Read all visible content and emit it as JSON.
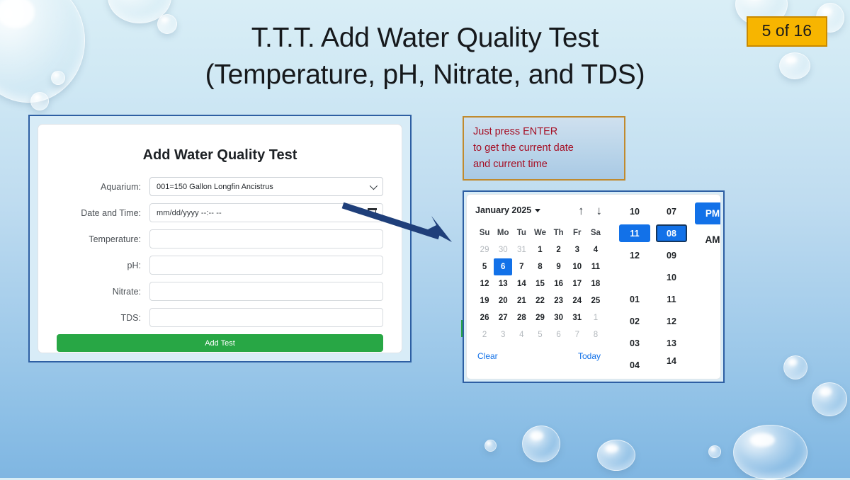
{
  "slide": {
    "title_line1": "T.T.T. Add Water Quality Test",
    "title_line2": "(Temperature, pH, Nitrate, and TDS)",
    "counter": "5 of 16",
    "counter_bg": "#f7b500",
    "background_top": "#d9eef6",
    "background_bottom": "#7fb6e2"
  },
  "form": {
    "heading": "Add Water Quality Test",
    "fields": [
      {
        "label": "Aquarium:",
        "value": "001=150 Gallon Longfin Ancistrus",
        "type": "select"
      },
      {
        "label": "Date and Time:",
        "value": "mm/dd/yyyy  --:--  --",
        "type": "datetime"
      },
      {
        "label": "Temperature:",
        "value": "",
        "type": "text"
      },
      {
        "label": "pH:",
        "value": "",
        "type": "text"
      },
      {
        "label": "Nitrate:",
        "value": "",
        "type": "text"
      },
      {
        "label": "TDS:",
        "value": "",
        "type": "text"
      }
    ],
    "submit_label": "Add Test",
    "submit_color": "#28a745",
    "frame_border": "#2e5fa3"
  },
  "note": {
    "line1": "Just press ENTER",
    "line2": "to get the current date",
    "line3": "and current time",
    "text_color": "#a50f25",
    "border_color": "#c08a2e"
  },
  "picker": {
    "month_label": "January 2025",
    "nav_up": "↑",
    "nav_down": "↓",
    "weekdays": [
      "Su",
      "Mo",
      "Tu",
      "We",
      "Th",
      "Fr",
      "Sa"
    ],
    "weeks": [
      [
        {
          "d": "29",
          "muted": true
        },
        {
          "d": "30",
          "muted": true
        },
        {
          "d": "31",
          "muted": true
        },
        {
          "d": "1"
        },
        {
          "d": "2"
        },
        {
          "d": "3"
        },
        {
          "d": "4"
        }
      ],
      [
        {
          "d": "5"
        },
        {
          "d": "6",
          "selected": true
        },
        {
          "d": "7"
        },
        {
          "d": "8"
        },
        {
          "d": "9"
        },
        {
          "d": "10"
        },
        {
          "d": "11"
        }
      ],
      [
        {
          "d": "12"
        },
        {
          "d": "13"
        },
        {
          "d": "14"
        },
        {
          "d": "15"
        },
        {
          "d": "16"
        },
        {
          "d": "17"
        },
        {
          "d": "18"
        }
      ],
      [
        {
          "d": "19"
        },
        {
          "d": "20"
        },
        {
          "d": "21"
        },
        {
          "d": "22"
        },
        {
          "d": "23"
        },
        {
          "d": "24"
        },
        {
          "d": "25"
        }
      ],
      [
        {
          "d": "26"
        },
        {
          "d": "27"
        },
        {
          "d": "28"
        },
        {
          "d": "29"
        },
        {
          "d": "30"
        },
        {
          "d": "31"
        },
        {
          "d": "1",
          "muted": true
        }
      ],
      [
        {
          "d": "2",
          "muted": true
        },
        {
          "d": "3",
          "muted": true
        },
        {
          "d": "4",
          "muted": true
        },
        {
          "d": "5",
          "muted": true
        },
        {
          "d": "6",
          "muted": true
        },
        {
          "d": "7",
          "muted": true
        },
        {
          "d": "8",
          "muted": true
        }
      ]
    ],
    "hours": [
      {
        "v": "10"
      },
      {
        "v": "11",
        "selected": true
      },
      {
        "v": "12"
      },
      {
        "v": ""
      },
      {
        "v": "01"
      },
      {
        "v": "02"
      },
      {
        "v": "03"
      },
      {
        "v": "04"
      }
    ],
    "minutes": [
      {
        "v": "07"
      },
      {
        "v": "08",
        "selected": true,
        "focused": true
      },
      {
        "v": "09"
      },
      {
        "v": "10"
      },
      {
        "v": "11"
      },
      {
        "v": "12"
      },
      {
        "v": "13"
      },
      {
        "v": "14",
        "clipped": true
      }
    ],
    "meridiem": [
      {
        "v": "PM",
        "selected": true
      },
      {
        "v": "AM"
      }
    ],
    "clear_label": "Clear",
    "today_label": "Today",
    "accent": "#1271e8",
    "frame_border": "#2e5fa3"
  }
}
